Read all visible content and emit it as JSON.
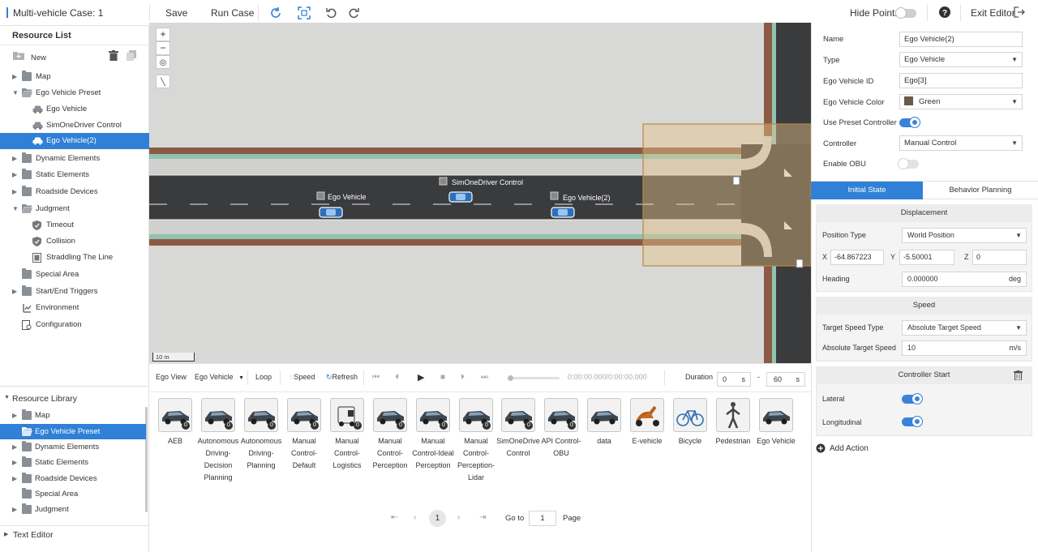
{
  "topbar": {
    "case_title": "Multi-vehicle Case: 1",
    "save_label": "Save",
    "run_case_label": "Run Case",
    "hide_points_label": "Hide Points",
    "hide_points_on": false,
    "exit_editor_label": "Exit Editor"
  },
  "resource_list": {
    "title": "Resource List",
    "new_label": "New",
    "items": [
      {
        "label": "Map",
        "kind": "folder",
        "expanded": false
      },
      {
        "label": "Ego Vehicle Preset",
        "kind": "folder",
        "expanded": true
      },
      {
        "label": "Ego Vehicle",
        "kind": "car"
      },
      {
        "label": "SimOneDriver Control",
        "kind": "car"
      },
      {
        "label": "Ego Vehicle(2)",
        "kind": "car",
        "selected": true
      },
      {
        "label": "Dynamic Elements",
        "kind": "folder",
        "expanded": false
      },
      {
        "label": "Static Elements",
        "kind": "folder",
        "expanded": false
      },
      {
        "label": "Roadside Devices",
        "kind": "folder",
        "expanded": false
      },
      {
        "label": "Judgment",
        "kind": "folder",
        "expanded": true
      },
      {
        "label": "Timeout",
        "kind": "shield"
      },
      {
        "label": "Collision",
        "kind": "shield"
      },
      {
        "label": "Straddling The Line",
        "kind": "doc"
      },
      {
        "label": "Special Area",
        "kind": "folder"
      },
      {
        "label": "Start/End Triggers",
        "kind": "folder",
        "expanded": false
      },
      {
        "label": "Environment",
        "kind": "env"
      },
      {
        "label": "Configuration",
        "kind": "config"
      }
    ]
  },
  "resource_library": {
    "title": "Resource Library",
    "items": [
      {
        "label": "Map"
      },
      {
        "label": "Ego Vehicle Preset",
        "selected": true
      },
      {
        "label": "Dynamic Elements"
      },
      {
        "label": "Static Elements"
      },
      {
        "label": "Roadside Devices"
      },
      {
        "label": "Special Area"
      },
      {
        "label": "Judgment"
      }
    ]
  },
  "text_editor_label": "Text Editor",
  "map": {
    "scale_label": "10 m",
    "vehicles": [
      "Ego Vehicle",
      "SimOneDriver Control",
      "Ego Vehicle(2)"
    ]
  },
  "playback": {
    "ego_view_label": "Ego View",
    "ego_select": "Ego Vehicle",
    "loop_label": "Loop",
    "speed_label": "Speed",
    "refresh_label": "Refresh",
    "time_display": "0:00:00.000/0:00:00.000",
    "duration_label": "Duration",
    "duration_from": "0",
    "duration_to": "60",
    "unit": "s",
    "dash": "-"
  },
  "library_cards": [
    {
      "label": "AEB",
      "badge": "0",
      "kind": "car"
    },
    {
      "label": "Autonomous Driving-Decision Planning",
      "badge": "0",
      "kind": "car"
    },
    {
      "label": "Autonomous Driving-Planning",
      "badge": "0",
      "kind": "car"
    },
    {
      "label": "Manual Control-Default",
      "badge": "0",
      "kind": "car"
    },
    {
      "label": "Manual Control-Logistics",
      "badge": "0",
      "kind": "truck"
    },
    {
      "label": "Manual Control-Perception",
      "badge": "0",
      "kind": "car"
    },
    {
      "label": "Manual Control-Ideal Perception",
      "badge": "0",
      "kind": "car"
    },
    {
      "label": "Manual Control-Perception-Lidar",
      "badge": "0",
      "kind": "car"
    },
    {
      "label": "SimOneDrive Control",
      "badge": "0",
      "kind": "car"
    },
    {
      "label": "API Control-OBU",
      "badge": "0",
      "kind": "car"
    },
    {
      "label": "data",
      "badge": "",
      "kind": "car"
    },
    {
      "label": "E-vehicle",
      "badge": "",
      "kind": "scooter"
    },
    {
      "label": "Bicycle",
      "badge": "",
      "kind": "bicycle"
    },
    {
      "label": "Pedestrian",
      "badge": "",
      "kind": "pedestrian"
    },
    {
      "label": "Ego Vehicle",
      "badge": "",
      "kind": "car"
    }
  ],
  "pagination": {
    "current_page": "1",
    "goto_label": "Go to",
    "goto_value": "1",
    "page_label": "Page"
  },
  "properties": {
    "name_label": "Name",
    "name_value": "Ego Vehicle(2)",
    "type_label": "Type",
    "type_value": "Ego Vehicle",
    "id_label": "Ego Vehicle ID",
    "id_value": "Ego[3]",
    "color_label": "Ego Vehicle Color",
    "color_value": "Green",
    "color_swatch": "#6b5a45",
    "preset_label": "Use Preset Controller",
    "preset_on": true,
    "controller_label": "Controller",
    "controller_value": "Manual Control",
    "obu_label": "Enable OBU",
    "obu_on": false
  },
  "tabs": {
    "initial_state": "Initial State",
    "behavior_planning": "Behavior Planning",
    "active": "initial_state"
  },
  "displacement": {
    "title": "Displacement",
    "position_type_label": "Position Type",
    "position_type_value": "World Position",
    "x_label": "X",
    "x_value": "-64.867223",
    "y_label": "Y",
    "y_value": "-5.50001",
    "z_label": "Z",
    "z_value": "0",
    "heading_label": "Heading",
    "heading_value": "0.000000",
    "heading_unit": "deg"
  },
  "speed": {
    "title": "Speed",
    "target_type_label": "Target Speed Type",
    "target_type_value": "Absolute Target Speed",
    "abs_speed_label": "Absolute Target Speed",
    "abs_speed_value": "10",
    "abs_speed_unit": "m/s"
  },
  "controller_start": {
    "title": "Controller Start",
    "lateral_label": "Lateral",
    "lateral_on": true,
    "longitudinal_label": "Longitudinal",
    "longitudinal_on": true
  },
  "add_action_label": "Add Action",
  "colors": {
    "accent": "#2f80d6",
    "road": "#3a3b3d",
    "curb": "#8a5a44",
    "grass": "#8fc3b0"
  }
}
